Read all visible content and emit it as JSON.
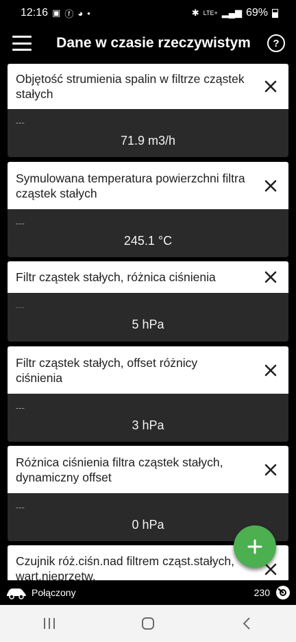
{
  "status_bar": {
    "time": "12:16",
    "battery": "69%",
    "network": "LTE+"
  },
  "app_bar": {
    "title": "Dane w czasie rzeczywistym",
    "menu_icon": "hamburger-menu-icon",
    "help_icon": "help-circle-icon"
  },
  "cards": [
    {
      "title": "Objętość strumienia spalin w filtrze cząstek stałych",
      "sub": "---",
      "value": "71.9 m3/h"
    },
    {
      "title": "Symulowana temperatura powierzchni filtra cząstek stałych",
      "sub": "---",
      "value": "245.1 °C"
    },
    {
      "title": "Filtr cząstek stałych, różnica ciśnienia",
      "sub": "---",
      "value": "5 hPa"
    },
    {
      "title": "Filtr cząstek stałych, offset różnicy ciśnienia",
      "sub": "---",
      "value": "3 hPa"
    },
    {
      "title": "Różnica ciśnienia filtra cząstek stałych, dynamiczny offset",
      "sub": "---",
      "value": "0 hPa"
    },
    {
      "title": "Czujnik róż.ciśn.nad filtrem cząst.stałych, wart.nieprzetw.",
      "sub": "",
      "value": ""
    }
  ],
  "fab": {
    "icon": "plus-icon"
  },
  "bottom_status": {
    "connection_label": "Połączony",
    "count": "230"
  },
  "colors": {
    "background": "#000000",
    "card_header": "#ffffff",
    "card_body": "#2a2a2a",
    "fab": "#4caf50"
  }
}
